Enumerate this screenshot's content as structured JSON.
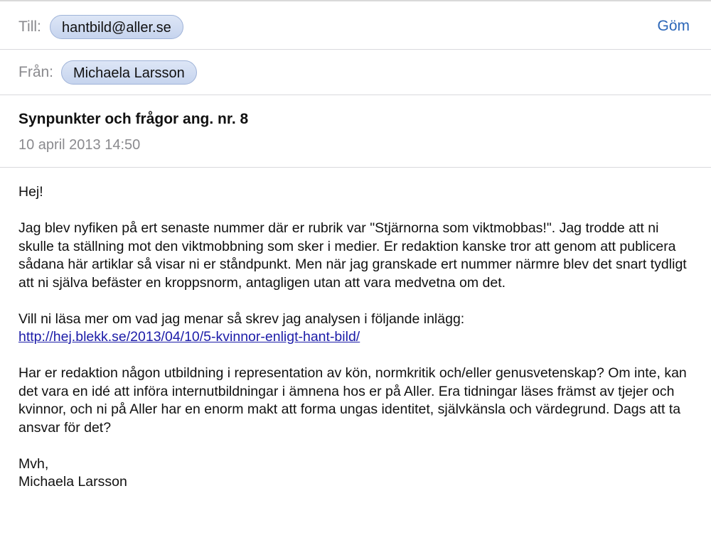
{
  "header": {
    "to_label": "Till:",
    "to_address": "hantbild@aller.se",
    "hide_label": "Göm",
    "from_label": "Från:",
    "from_name": "Michaela Larsson"
  },
  "message": {
    "subject": "Synpunkter och frågor ang. nr. 8",
    "date": "10 april 2013 14:50",
    "greeting": "Hej!",
    "paragraph1": "Jag blev nyfiken på ert senaste nummer där er rubrik var \"Stjärnorna som viktmobbas!\". Jag trodde att ni skulle ta ställning mot den viktmobbning som sker i medier. Er redaktion kanske tror att genom att publicera sådana här artiklar så visar ni er ståndpunkt. Men när jag granskade ert nummer närmre blev det snart tydligt att ni själva befäster en kroppsnorm, antagligen utan att vara medvetna om det.",
    "paragraph2_intro": "Vill ni läsa mer om vad jag menar så skrev jag analysen i följande inlägg:",
    "link": "http://hej.blekk.se/2013/04/10/5-kvinnor-enligt-hant-bild/",
    "paragraph3": "Har er redaktion någon utbildning i representation av kön, normkritik och/eller genusvetenskap? Om inte, kan det vara en idé att införa internutbildningar i ämnena hos er på Aller. Era tidningar läses främst av tjejer och kvinnor, och ni på Aller har en enorm makt att forma ungas identitet, självkänsla och värdegrund. Dags att ta ansvar för det?",
    "signoff": "Mvh,",
    "signature": "Michaela Larsson"
  },
  "colors": {
    "chip_background": "#c6d4ee",
    "label_gray": "#8a8a8e",
    "hide_link_blue": "#2b66b8",
    "body_link": "#1c1ca8"
  }
}
